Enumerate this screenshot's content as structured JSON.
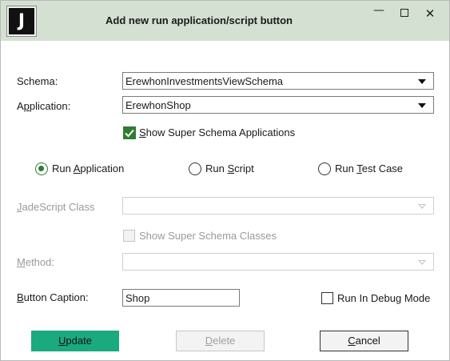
{
  "window": {
    "title": "Add new run application/script button",
    "app_icon_letter": "J",
    "minimize_glyph": "—",
    "close_glyph": "✕"
  },
  "form": {
    "schema": {
      "label_pre": "Schema:",
      "value": "ErewhonInvestmentsViewSchema"
    },
    "application": {
      "label_pre": "A",
      "label_u": "p",
      "label_post": "plication:",
      "value": "ErewhonShop"
    },
    "show_super_schema_apps": {
      "label_pre": "",
      "label_u": "S",
      "label_post": "how Super Schema Applications",
      "checked": true
    },
    "run_mode": {
      "run_application": {
        "label_pre": "Run ",
        "label_u": "A",
        "label_post": "pplication",
        "selected": true
      },
      "run_script": {
        "label_pre": "Run ",
        "label_u": "S",
        "label_post": "cript",
        "selected": false
      },
      "run_test_case": {
        "label_pre": "Run ",
        "label_u": "T",
        "label_post": "est Case",
        "selected": false
      }
    },
    "jadescript_class": {
      "label_pre": "",
      "label_u": "J",
      "label_post": "adeScript Class",
      "value": "",
      "disabled": true
    },
    "show_super_schema_classes": {
      "label": "Show Super Schema Classes",
      "checked": false,
      "disabled": true
    },
    "method": {
      "label_pre": "",
      "label_u": "M",
      "label_post": "ethod:",
      "value": "",
      "disabled": true
    },
    "button_caption": {
      "label_pre": "",
      "label_u": "B",
      "label_post": "utton Caption:",
      "value": "Shop"
    },
    "run_in_debug_mode": {
      "label": "Run In Debug Mode",
      "checked": false
    }
  },
  "buttons": {
    "update": {
      "label_u": "U",
      "label_post": "pdate"
    },
    "delete": {
      "label_u": "D",
      "label_post": "elete"
    },
    "cancel": {
      "label_u": "C",
      "label_post": "ancel"
    }
  },
  "colors": {
    "titlebar": "#d4e0d1",
    "accent_green": "#2e7d32",
    "update_button": "#1aaa7d",
    "disabled_text": "#9a9a9a"
  },
  "icons": {
    "app": "jade-app-icon",
    "minimize": "minimize-icon",
    "maximize": "maximize-icon",
    "close": "close-icon",
    "dropdown": "chevron-down-icon",
    "check": "checkmark-icon"
  }
}
